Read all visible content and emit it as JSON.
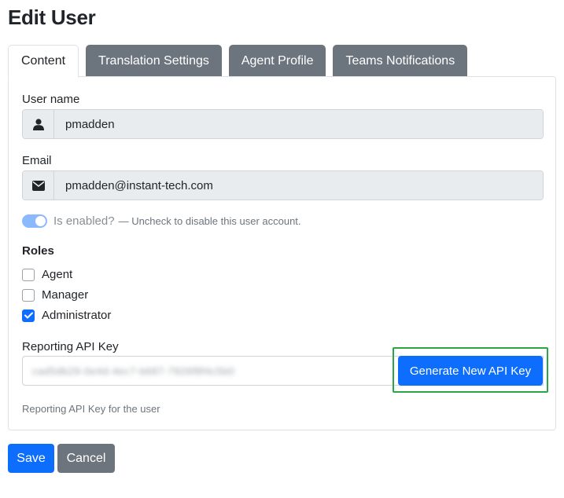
{
  "page": {
    "title": "Edit User"
  },
  "tabs": [
    {
      "label": "Content",
      "active": true
    },
    {
      "label": "Translation Settings",
      "active": false
    },
    {
      "label": "Agent Profile",
      "active": false
    },
    {
      "label": "Teams Notifications",
      "active": false
    }
  ],
  "form": {
    "username": {
      "label": "User name",
      "value": "pmadden",
      "icon": "user-icon"
    },
    "email": {
      "label": "Email",
      "value": "pmadden@instant-tech.com",
      "icon": "envelope-icon"
    },
    "enabled": {
      "label": "Is enabled?",
      "help": "— Uncheck to disable this user account.",
      "checked": true
    },
    "roles": {
      "title": "Roles",
      "items": [
        {
          "label": "Agent",
          "checked": false
        },
        {
          "label": "Manager",
          "checked": false
        },
        {
          "label": "Administrator",
          "checked": true
        }
      ]
    },
    "api_key": {
      "label": "Reporting API Key",
      "value": "cad5db29-0e4d-4ec7-b687-7926f8f4c5b0",
      "generate_label": "Generate New API Key",
      "help": "Reporting API Key for the user"
    }
  },
  "actions": {
    "save_label": "Save",
    "cancel_label": "Cancel"
  },
  "colors": {
    "primary": "#0d6efd",
    "secondary": "#6c757d",
    "highlight": "#28a745"
  }
}
